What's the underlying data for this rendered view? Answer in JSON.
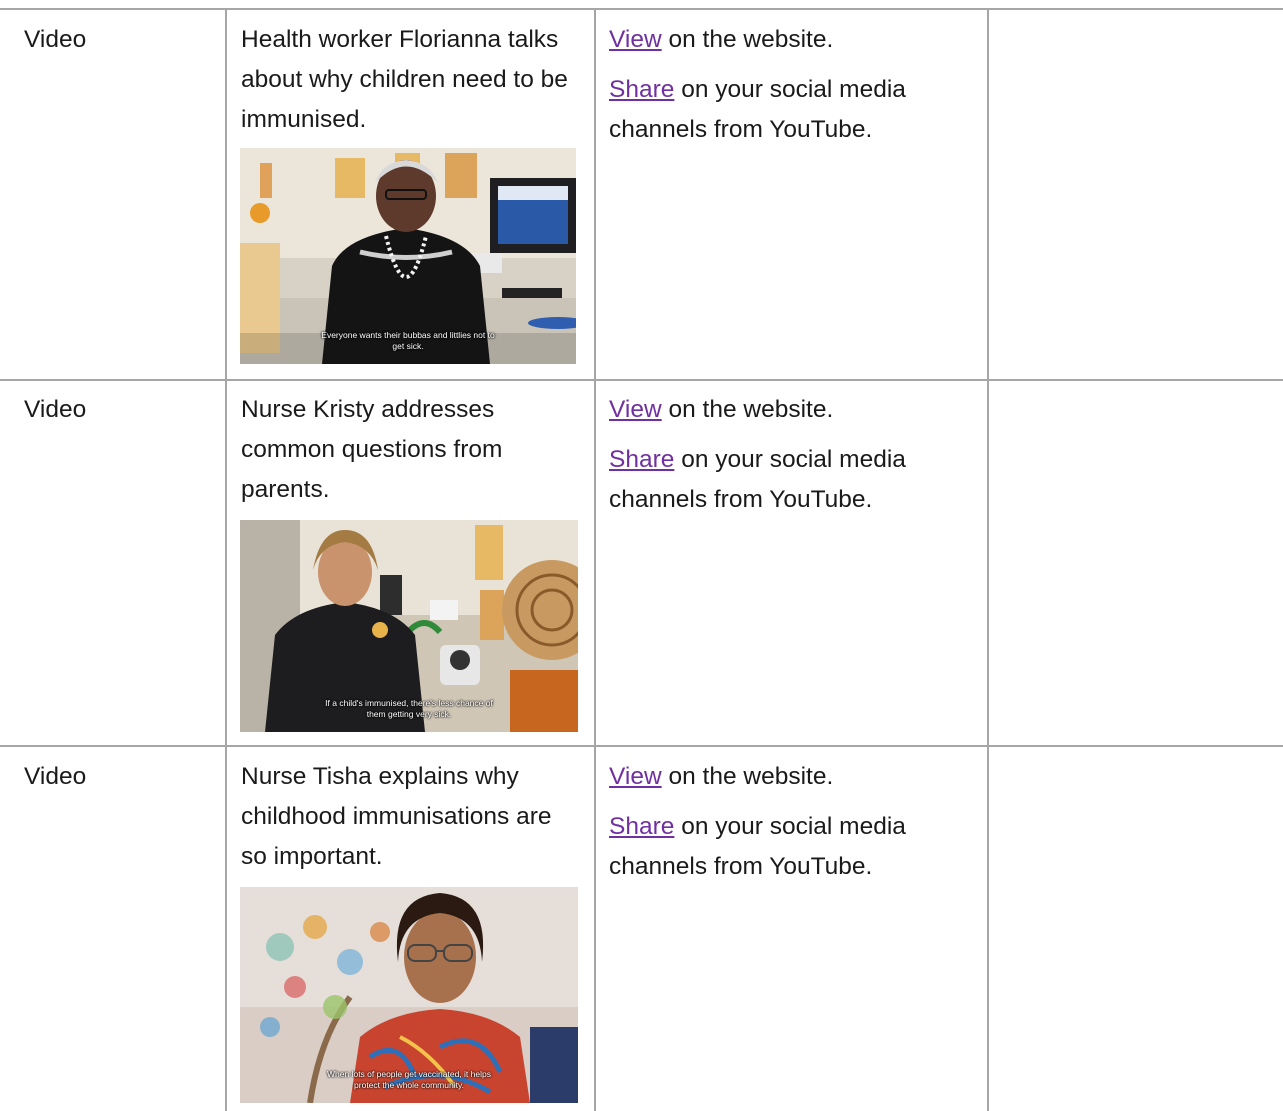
{
  "rows": [
    {
      "type": "Video",
      "description": "Health worker Florianna talks about why children need to be immunised.",
      "thumbnail": {
        "subject": "health-worker-florianna",
        "caption_line1": "Everyone wants their bubbas and littlies not to",
        "caption_line2": "get sick."
      },
      "view_link": "View",
      "view_text": " on the website.",
      "share_link": "Share",
      "share_text": " on your social media channels from YouTube."
    },
    {
      "type": "Video",
      "description": "Nurse Kristy addresses common questions from parents.",
      "thumbnail": {
        "subject": "nurse-kristy",
        "caption_line1": "If a child's immunised, there's less chance of",
        "caption_line2": "them getting very sick."
      },
      "view_link": "View",
      "view_text": " on the website.",
      "share_link": "Share",
      "share_text": " on your social media channels from YouTube."
    },
    {
      "type": "Video",
      "description": "Nurse Tisha explains why childhood immunisations are so important.",
      "thumbnail": {
        "subject": "nurse-tisha",
        "caption_line1": "When lots of people get vaccinated, it helps",
        "caption_line2": "protect the whole community."
      },
      "view_link": "View",
      "view_text": " on the website.",
      "share_link": "Share",
      "share_text": " on your social media channels from YouTube."
    }
  ],
  "colors": {
    "link": "#7030a0",
    "border": "#a6a6a6",
    "text": "#1a1a1a"
  }
}
